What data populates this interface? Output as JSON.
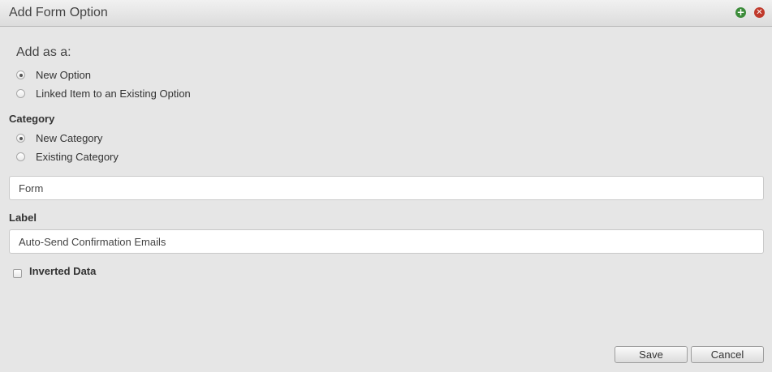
{
  "dialog": {
    "title": "Add Form Option",
    "add_icon": "plus-circle-icon",
    "close_icon": "x-circle-icon"
  },
  "add_as": {
    "heading": "Add as a:",
    "options": [
      {
        "label": "New Option",
        "checked": true
      },
      {
        "label": "Linked Item to an Existing Option",
        "checked": false
      }
    ]
  },
  "category": {
    "heading": "Category",
    "options": [
      {
        "label": "New Category",
        "checked": true
      },
      {
        "label": "Existing Category",
        "checked": false
      }
    ],
    "input_value": "Form"
  },
  "label_field": {
    "heading": "Label",
    "input_value": "Auto-Send Confirmation Emails"
  },
  "inverted": {
    "label": "Inverted Data",
    "checked": false
  },
  "buttons": {
    "save": "Save",
    "cancel": "Cancel"
  },
  "colors": {
    "add_icon": "#3c8c3a",
    "close_icon": "#c0392b",
    "background": "#e6e6e6"
  }
}
